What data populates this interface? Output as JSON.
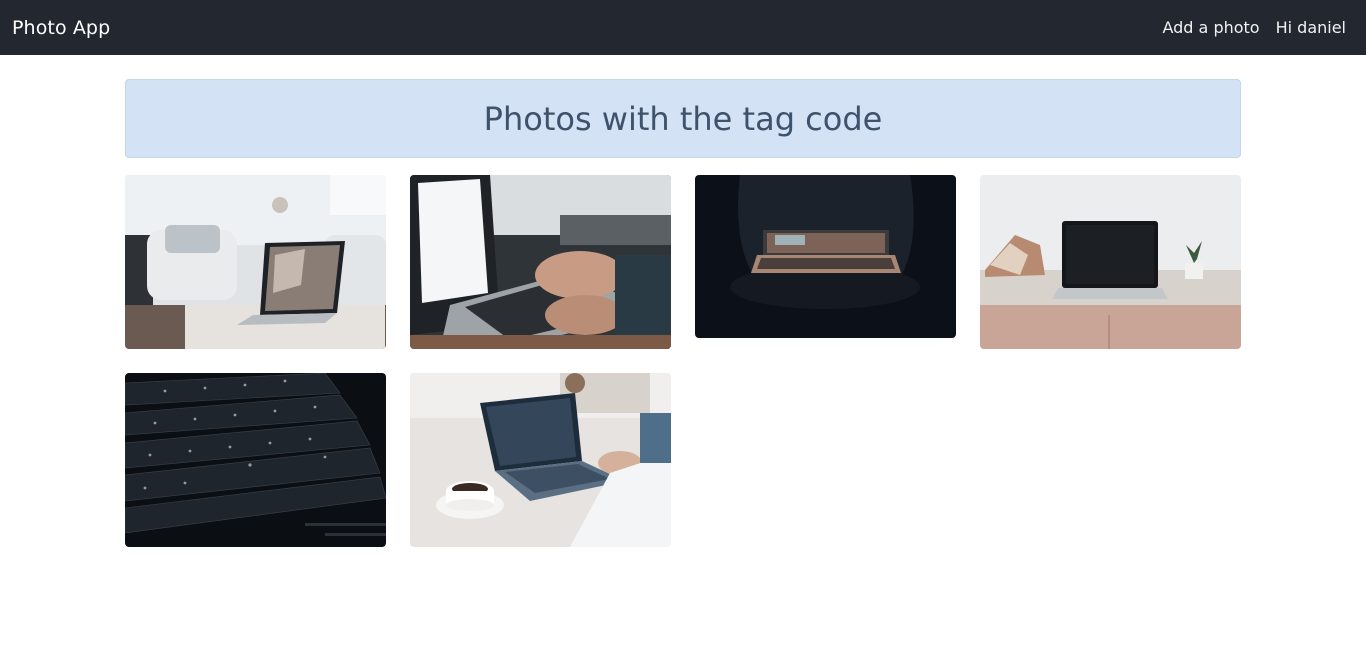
{
  "nav": {
    "brand": "Photo App",
    "add_photo": "Add a photo",
    "greeting": "Hi daniel"
  },
  "header": {
    "title": "Photos with the tag code"
  },
  "photos": [
    {
      "name": "laptop-living-room-photo"
    },
    {
      "name": "typing-on-laptop-photo"
    },
    {
      "name": "laptop-dark-photo"
    },
    {
      "name": "laptop-desk-photo"
    },
    {
      "name": "keyboard-closeup-photo"
    },
    {
      "name": "laptop-coffee-photo"
    }
  ],
  "colors": {
    "navbar": "#23272f",
    "header_bg": "#d3e2f4",
    "header_text": "#3e536b"
  }
}
